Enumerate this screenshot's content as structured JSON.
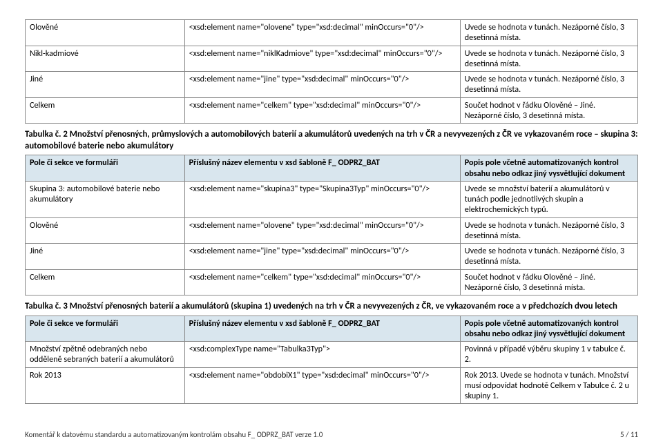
{
  "table1_tail_rows": [
    {
      "c1": "Olověné",
      "c2": "<xsd:element name=\"olovene\" type=\"xsd:decimal\" minOccurs=\"0\"/>",
      "c3": "Uvede se hodnota v tunách. Nezáporné číslo, 3 desetinná místa."
    },
    {
      "c1": "Nikl-kadmiové",
      "c2": "<xsd:element name=\"niklKadmiove\" type=\"xsd:decimal\" minOccurs=\"0\"/>",
      "c3": "Uvede se hodnota v tunách. Nezáporné číslo, 3 desetinná místa."
    },
    {
      "c1": "Jiné",
      "c2": "<xsd:element name=\"jine\" type=\"xsd:decimal\" minOccurs=\"0\"/>",
      "c3": "Uvede se hodnota v tunách. Nezáporné číslo, 3 desetinná místa."
    },
    {
      "c1": "Celkem",
      "c2": "<xsd:element name=\"celkem\" type=\"xsd:decimal\" minOccurs=\"0\"/>",
      "c3": "Součet hodnot v řádku Olověné – Jiné. Nezáporné číslo, 3 desetinná místa."
    }
  ],
  "section2_title": "Tabulka č. 2 Množství přenosných, průmyslových a automobilových baterií a akumulátorů uvedených na trh v ČR a nevyvezených z ČR ve vykazovaném roce – skupina 3: automobilové baterie nebo akumulátory",
  "table2_headers": {
    "h1": "Pole či sekce ve formuláři",
    "h2": "Příslušný název elementu v xsd šabloně F_ ODPRZ_BAT",
    "h3": "Popis pole včetně automatizovaných kontrol obsahu nebo odkaz jiný vysvětlující dokument"
  },
  "table2_rows": [
    {
      "c1": "Skupina 3: automobilové baterie nebo akumulátory",
      "c2": "<xsd:element name=\"skupina3\" type=\"Skupina3Typ\" minOccurs=\"0\"/>",
      "c3": "Uvede se množství baterií a akumulátorů v tunách podle jednotlivých skupin a elektrochemických typů."
    },
    {
      "c1": "Olověné",
      "c2": "<xsd:element name=\"olovene\" type=\"xsd:decimal\" minOccurs=\"0\"/>",
      "c3": "Uvede se hodnota v tunách. Nezáporné číslo, 3 desetinná místa."
    },
    {
      "c1": "Jiné",
      "c2": "<xsd:element name=\"jine\" type=\"xsd:decimal\" minOccurs=\"0\"/>",
      "c3": "Uvede se hodnota v tunách. Nezáporné číslo, 3 desetinná místa."
    },
    {
      "c1": "Celkem",
      "c2": "<xsd:element name=\"celkem\" type=\"xsd:decimal\" minOccurs=\"0\"/>",
      "c3": "Součet hodnot v řádku Olověné – Jiné. Nezáporné číslo, 3 desetinná místa."
    }
  ],
  "section3_title": "Tabulka č. 3 Množství přenosných baterií a akumulátorů (skupina 1) uvedených na trh v ČR a nevyvezených z ČR, ve vykazovaném roce a v předchozích dvou letech",
  "table3_headers": {
    "h1": "Pole či sekce ve formuláři",
    "h2": "Příslušný název elementu v xsd šabloně F_ ODPRZ_BAT",
    "h3": "Popis pole včetně automatizovaných kontrol obsahu nebo odkaz jiný vysvětlující dokument"
  },
  "table3_rows": [
    {
      "c1": "Množství zpětně odebraných nebo odděleně sebraných baterií a akumulátorů",
      "c2": "<xsd:complexType name=\"Tabulka3Typ\">",
      "c3": "Povinná v případě výběru skupiny 1 v tabulce č. 2."
    },
    {
      "c1": "Rok 2013",
      "c2": "<xsd:element name=\"obdobiX1\" type=\"xsd:decimal\" minOccurs=\"0\"/>",
      "c3": "Rok 2013. Uvede se hodnota v tunách. Množství musí odpovídat hodnotě Celkem v Tabulce č. 2 u skupiny 1."
    }
  ],
  "footer_left": "Komentář k datovému standardu a automatizovaným kontrolám obsahu F_ ODPRZ_BAT verze 1.0",
  "footer_right": "5 / 11"
}
